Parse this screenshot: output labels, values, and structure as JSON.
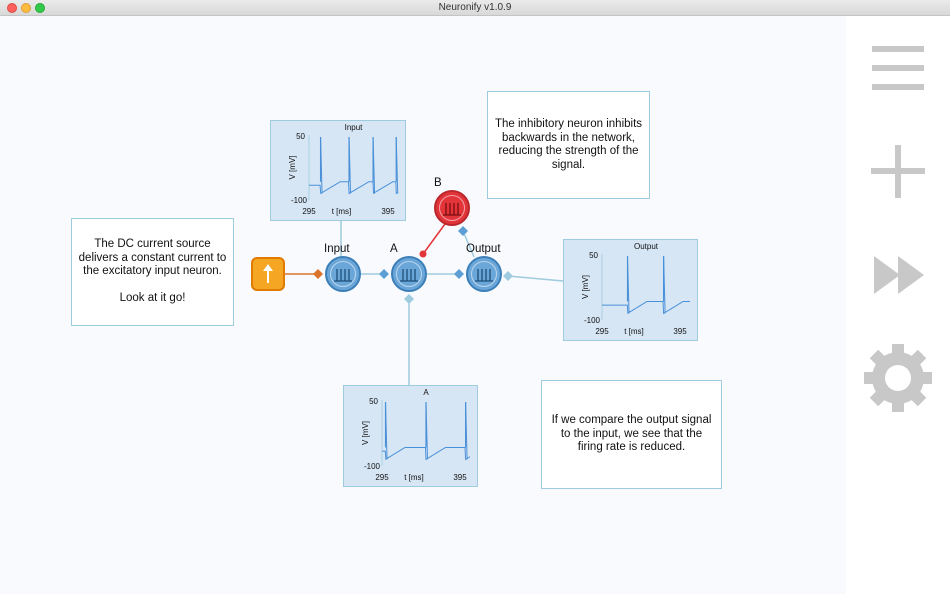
{
  "window": {
    "title": "Neuronify v1.0.9"
  },
  "notes": {
    "dc": "The DC current source delivers a constant current to the excitatory input neuron.\n\nLook at it go!",
    "inhibitory": "The inhibitory neuron inhibits backwards in the network, reducing the strength of the signal.",
    "compare": "If we compare the output signal to the input, we see that the firing rate is reduced."
  },
  "neurons": {
    "input": {
      "label": "Input",
      "type": "excitatory"
    },
    "a": {
      "label": "A",
      "type": "excitatory"
    },
    "output": {
      "label": "Output",
      "type": "excitatory"
    },
    "b": {
      "label": "B",
      "type": "inhibitory"
    }
  },
  "scopes": {
    "input": {
      "title": "Input",
      "ymax": "50",
      "ymin": "-100",
      "xmin": "295",
      "xmax": "395",
      "ylabel": "V [mV]",
      "xlabel": "t [ms]",
      "spikes": [
        0.13,
        0.45,
        0.72,
        0.98
      ]
    },
    "a": {
      "title": "A",
      "ymax": "50",
      "ymin": "-100",
      "xmin": "295",
      "xmax": "395",
      "ylabel": "V [mV]",
      "xlabel": "t [ms]",
      "spikes": [
        0.04,
        0.5,
        0.95
      ]
    },
    "output": {
      "title": "Output",
      "ymax": "50",
      "ymin": "-100",
      "xmin": "295",
      "xmax": "395",
      "ylabel": "V [mV]",
      "xlabel": "t [ms]",
      "spikes": [
        0.29,
        0.7
      ]
    }
  },
  "sidebar": [
    {
      "icon": "menu-icon"
    },
    {
      "icon": "add-icon"
    },
    {
      "icon": "fast-forward-icon"
    },
    {
      "icon": "settings-icon"
    }
  ],
  "colors": {
    "excitatory": "#6aa6d8",
    "inhibitory": "#e3343a",
    "dc_source": "#f5a623",
    "trace": "#4a90d9",
    "wire": "#9ecbdd",
    "sidebar_icon": "#c8c8c8"
  }
}
